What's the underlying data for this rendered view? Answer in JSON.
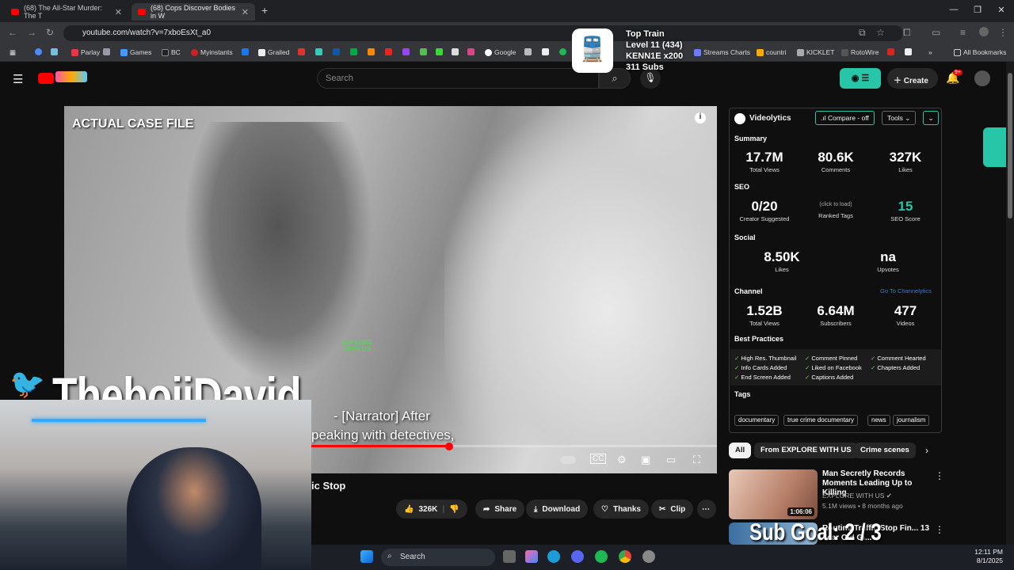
{
  "browser": {
    "tabs": [
      {
        "title": "(68) The All-Star Murder: The T",
        "active": false
      },
      {
        "title": "(68) Cops Discover Bodies in W",
        "active": true
      }
    ],
    "url": "youtube.com/watch?v=7xboEsXt_a0",
    "bookmarks": [
      "Parlay",
      "Games",
      "BC",
      "Myinstants",
      "Grailed",
      "Google",
      "Streams Charts",
      "countri",
      "KICKLET",
      "RotoWire"
    ],
    "all_bookmarks_label": "All Bookmarks"
  },
  "youtube": {
    "search_placeholder": "Search",
    "create_label": "Create",
    "notif_count": "9+",
    "video": {
      "overlay_label": "ACTUAL CASE FILE",
      "watermark": "EXPLORE WITH US",
      "caption_line1": "- [Narrator] After",
      "caption_line2": "peaking with detectives,",
      "progress": 0.59,
      "title_fragment": "ic Stop"
    },
    "actions": {
      "likes": "326K",
      "share": "Share",
      "download": "Download",
      "thanks": "Thanks",
      "clip": "Clip"
    },
    "chips": [
      "All",
      "From EXPLORE WITH US",
      "Crime scenes"
    ],
    "related": [
      {
        "title": "Man Secretly Records Moments Leading Up to Killing",
        "channel": "EXPLORE WITH US",
        "meta": "5.1M views • 8 months ago",
        "duration": "1:06:06"
      },
      {
        "title": "Routine Traffic Stop Fin... 13 Year Old Gi...",
        "channel": "",
        "meta": "",
        "duration": ""
      }
    ]
  },
  "stream_overlay": {
    "train_title": "Top Train",
    "train_level": "Level 11  (434)",
    "train_user": "KENN1E x200",
    "train_subs": "311 Subs",
    "handle": "TheboiiDavid",
    "sub_goal": "Sub Goal: 2 / 3"
  },
  "videolytics": {
    "title": "Videolytics",
    "compare_label": "Compare - off",
    "tools_label": "Tools",
    "summary_label": "Summary",
    "summary": [
      {
        "value": "17.7M",
        "label": "Total Views"
      },
      {
        "value": "80.6K",
        "label": "Comments"
      },
      {
        "value": "327K",
        "label": "Likes"
      }
    ],
    "seo_label": "SEO",
    "seo": [
      {
        "value": "0/20",
        "label": "Creator Suggested"
      },
      {
        "value": "(click to load)",
        "label": "Ranked Tags"
      },
      {
        "value": "15",
        "label": "SEO Score"
      }
    ],
    "social_label": "Social",
    "social": [
      {
        "value": "8.50K",
        "label": "Likes"
      },
      {
        "value": "na",
        "label": "Upvotes"
      }
    ],
    "channel_label": "Channel",
    "channel_link": "Go To Channelytics",
    "channel": [
      {
        "value": "1.52B",
        "label": "Total Views"
      },
      {
        "value": "6.64M",
        "label": "Subscribers"
      },
      {
        "value": "477",
        "label": "Videos"
      }
    ],
    "best_practices_label": "Best Practices",
    "best_practices": [
      "High Res. Thumbnail",
      "Comment Pinned",
      "Comment Hearted",
      "Info Cards Added",
      "Liked on Facebook",
      "Chapters Added",
      "End Screen Added",
      "Captions Added"
    ],
    "tags_label": "Tags",
    "tags": [
      "documentary",
      "true crime documentary",
      "news",
      "journalism"
    ]
  },
  "taskbar": {
    "search_label": "Search",
    "time": "12:11 PM",
    "date": "8/1/2025"
  },
  "colors": {
    "accent_red": "#ff0000",
    "videolytics_teal": "#27c6a8",
    "twitter_blue": "#1d9bf0"
  }
}
